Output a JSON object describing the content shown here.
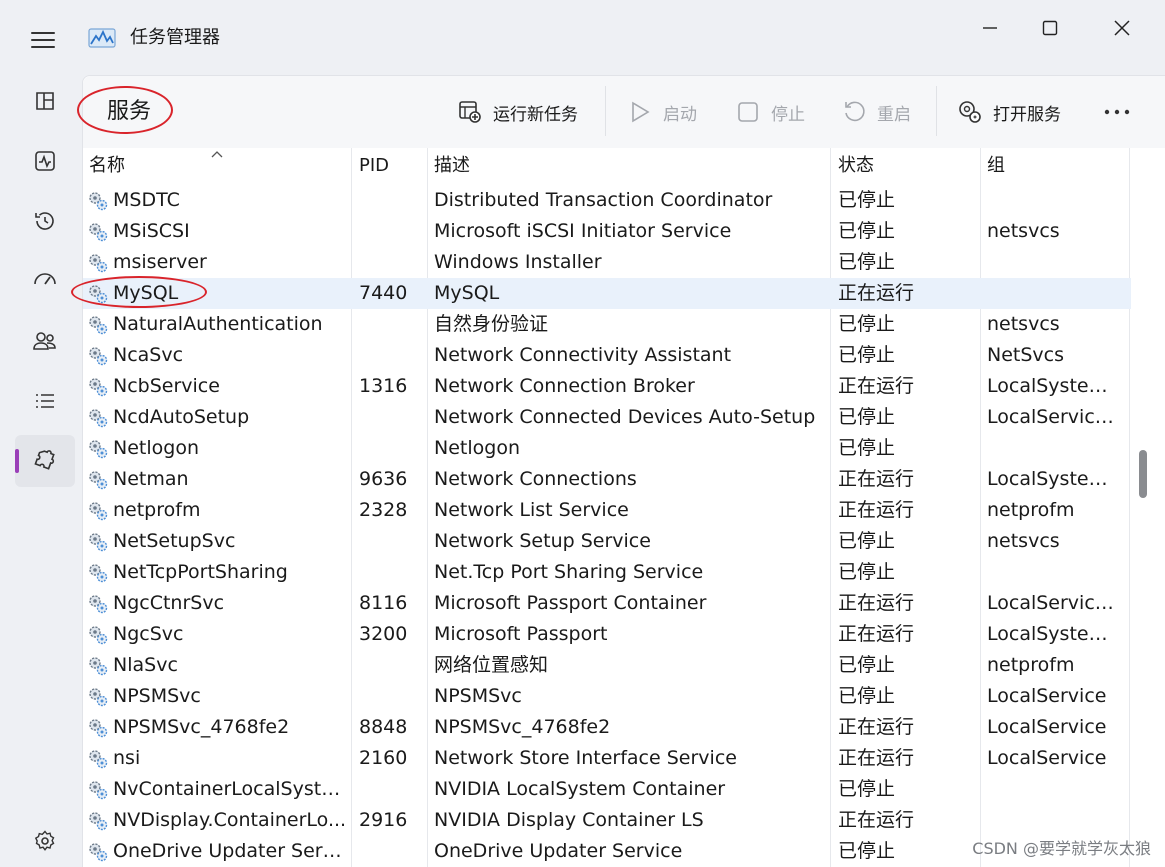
{
  "window": {
    "title": "任务管理器",
    "icons": {
      "menu": "hamburger-icon",
      "app": "performance-graph-icon",
      "minimize": "minimize-icon",
      "maximize": "maximize-icon",
      "close": "close-icon"
    }
  },
  "sidebar": {
    "items": [
      {
        "id": "processes",
        "icon": "processes-grid-icon"
      },
      {
        "id": "performance",
        "icon": "performance-pulse-icon"
      },
      {
        "id": "app-history",
        "icon": "history-clock-icon"
      },
      {
        "id": "startup",
        "icon": "startup-gauge-icon"
      },
      {
        "id": "users",
        "icon": "users-icon"
      },
      {
        "id": "details",
        "icon": "details-list-icon"
      },
      {
        "id": "services",
        "icon": "services-puzzle-icon",
        "active": true
      }
    ],
    "settings_icon": "settings-gear-icon",
    "accent": "#9a3fb8"
  },
  "toolbar": {
    "page_title": "服务",
    "run_new_task": "运行新任务",
    "start": "启动",
    "stop": "停止",
    "restart": "重启",
    "open_services": "打开服务",
    "more": "more-icon"
  },
  "table": {
    "headers": {
      "name": "名称",
      "pid": "PID",
      "desc": "描述",
      "status": "状态",
      "group": "组"
    },
    "rows": [
      {
        "name": "MSDTC",
        "pid": "",
        "desc": "Distributed Transaction Coordinator",
        "status": "已停止",
        "group": ""
      },
      {
        "name": "MSiSCSI",
        "pid": "",
        "desc": "Microsoft iSCSI Initiator Service",
        "status": "已停止",
        "group": "netsvcs"
      },
      {
        "name": "msiserver",
        "pid": "",
        "desc": "Windows Installer",
        "status": "已停止",
        "group": ""
      },
      {
        "name": "MySQL",
        "pid": "7440",
        "desc": "MySQL",
        "status": "正在运行",
        "group": ""
      },
      {
        "name": "NaturalAuthentication",
        "pid": "",
        "desc": "自然身份验证",
        "status": "已停止",
        "group": "netsvcs"
      },
      {
        "name": "NcaSvc",
        "pid": "",
        "desc": "Network Connectivity Assistant",
        "status": "已停止",
        "group": "NetSvcs"
      },
      {
        "name": "NcbService",
        "pid": "1316",
        "desc": "Network Connection Broker",
        "status": "正在运行",
        "group": "LocalSystem..."
      },
      {
        "name": "NcdAutoSetup",
        "pid": "",
        "desc": "Network Connected Devices Auto-Setup",
        "status": "已停止",
        "group": "LocalService..."
      },
      {
        "name": "Netlogon",
        "pid": "",
        "desc": "Netlogon",
        "status": "已停止",
        "group": ""
      },
      {
        "name": "Netman",
        "pid": "9636",
        "desc": "Network Connections",
        "status": "正在运行",
        "group": "LocalSystem..."
      },
      {
        "name": "netprofm",
        "pid": "2328",
        "desc": "Network List Service",
        "status": "正在运行",
        "group": "netprofm"
      },
      {
        "name": "NetSetupSvc",
        "pid": "",
        "desc": "Network Setup Service",
        "status": "已停止",
        "group": "netsvcs"
      },
      {
        "name": "NetTcpPortSharing",
        "pid": "",
        "desc": "Net.Tcp Port Sharing Service",
        "status": "已停止",
        "group": ""
      },
      {
        "name": "NgcCtnrSvc",
        "pid": "8116",
        "desc": "Microsoft Passport Container",
        "status": "正在运行",
        "group": "LocalService..."
      },
      {
        "name": "NgcSvc",
        "pid": "3200",
        "desc": "Microsoft Passport",
        "status": "正在运行",
        "group": "LocalSystem..."
      },
      {
        "name": "NlaSvc",
        "pid": "",
        "desc": "网络位置感知",
        "status": "已停止",
        "group": "netprofm"
      },
      {
        "name": "NPSMSvc",
        "pid": "",
        "desc": "NPSMSvc",
        "status": "已停止",
        "group": "LocalService"
      },
      {
        "name": "NPSMSvc_4768fe2",
        "pid": "8848",
        "desc": "NPSMSvc_4768fe2",
        "status": "正在运行",
        "group": "LocalService"
      },
      {
        "name": "nsi",
        "pid": "2160",
        "desc": "Network Store Interface Service",
        "status": "正在运行",
        "group": "LocalService"
      },
      {
        "name": "NvContainerLocalSyste...",
        "pid": "",
        "desc": "NVIDIA LocalSystem Container",
        "status": "已停止",
        "group": ""
      },
      {
        "name": "NVDisplay.ContainerLo...",
        "pid": "2916",
        "desc": "NVIDIA Display Container LS",
        "status": "正在运行",
        "group": ""
      },
      {
        "name": "OneDrive Updater Serv...",
        "pid": "",
        "desc": "OneDrive Updater Service",
        "status": "已停止",
        "group": ""
      }
    ],
    "selected_row": 3,
    "highlight_color": "#d9242b"
  },
  "watermark": "CSDN @要学就学灰太狼"
}
